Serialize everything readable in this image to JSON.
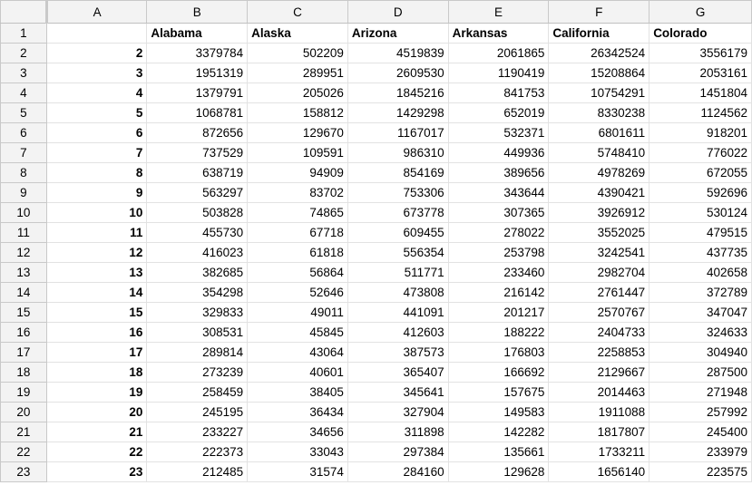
{
  "columns": [
    "A",
    "B",
    "C",
    "D",
    "E",
    "F",
    "G"
  ],
  "rows": [
    {
      "n": "1",
      "cells": [
        "",
        "Alabama",
        "Alaska",
        "Arizona",
        "Arkansas",
        "California",
        "Colorado"
      ]
    },
    {
      "n": "2",
      "cells": [
        "2",
        "3379784",
        "502209",
        "4519839",
        "2061865",
        "26342524",
        "3556179"
      ]
    },
    {
      "n": "3",
      "cells": [
        "3",
        "1951319",
        "289951",
        "2609530",
        "1190419",
        "15208864",
        "2053161"
      ]
    },
    {
      "n": "4",
      "cells": [
        "4",
        "1379791",
        "205026",
        "1845216",
        "841753",
        "10754291",
        "1451804"
      ]
    },
    {
      "n": "5",
      "cells": [
        "5",
        "1068781",
        "158812",
        "1429298",
        "652019",
        "8330238",
        "1124562"
      ]
    },
    {
      "n": "6",
      "cells": [
        "6",
        "872656",
        "129670",
        "1167017",
        "532371",
        "6801611",
        "918201"
      ]
    },
    {
      "n": "7",
      "cells": [
        "7",
        "737529",
        "109591",
        "986310",
        "449936",
        "5748410",
        "776022"
      ]
    },
    {
      "n": "8",
      "cells": [
        "8",
        "638719",
        "94909",
        "854169",
        "389656",
        "4978269",
        "672055"
      ]
    },
    {
      "n": "9",
      "cells": [
        "9",
        "563297",
        "83702",
        "753306",
        "343644",
        "4390421",
        "592696"
      ]
    },
    {
      "n": "10",
      "cells": [
        "10",
        "503828",
        "74865",
        "673778",
        "307365",
        "3926912",
        "530124"
      ]
    },
    {
      "n": "11",
      "cells": [
        "11",
        "455730",
        "67718",
        "609455",
        "278022",
        "3552025",
        "479515"
      ]
    },
    {
      "n": "12",
      "cells": [
        "12",
        "416023",
        "61818",
        "556354",
        "253798",
        "3242541",
        "437735"
      ]
    },
    {
      "n": "13",
      "cells": [
        "13",
        "382685",
        "56864",
        "511771",
        "233460",
        "2982704",
        "402658"
      ]
    },
    {
      "n": "14",
      "cells": [
        "14",
        "354298",
        "52646",
        "473808",
        "216142",
        "2761447",
        "372789"
      ]
    },
    {
      "n": "15",
      "cells": [
        "15",
        "329833",
        "49011",
        "441091",
        "201217",
        "2570767",
        "347047"
      ]
    },
    {
      "n": "16",
      "cells": [
        "16",
        "308531",
        "45845",
        "412603",
        "188222",
        "2404733",
        "324633"
      ]
    },
    {
      "n": "17",
      "cells": [
        "17",
        "289814",
        "43064",
        "387573",
        "176803",
        "2258853",
        "304940"
      ]
    },
    {
      "n": "18",
      "cells": [
        "18",
        "273239",
        "40601",
        "365407",
        "166692",
        "2129667",
        "287500"
      ]
    },
    {
      "n": "19",
      "cells": [
        "19",
        "258459",
        "38405",
        "345641",
        "157675",
        "2014463",
        "271948"
      ]
    },
    {
      "n": "20",
      "cells": [
        "20",
        "245195",
        "36434",
        "327904",
        "149583",
        "1911088",
        "257992"
      ]
    },
    {
      "n": "21",
      "cells": [
        "21",
        "233227",
        "34656",
        "311898",
        "142282",
        "1817807",
        "245400"
      ]
    },
    {
      "n": "22",
      "cells": [
        "22",
        "222373",
        "33043",
        "297384",
        "135661",
        "1733211",
        "233979"
      ]
    },
    {
      "n": "23",
      "cells": [
        "23",
        "212485",
        "31574",
        "284160",
        "129628",
        "1656140",
        "223575"
      ]
    }
  ]
}
